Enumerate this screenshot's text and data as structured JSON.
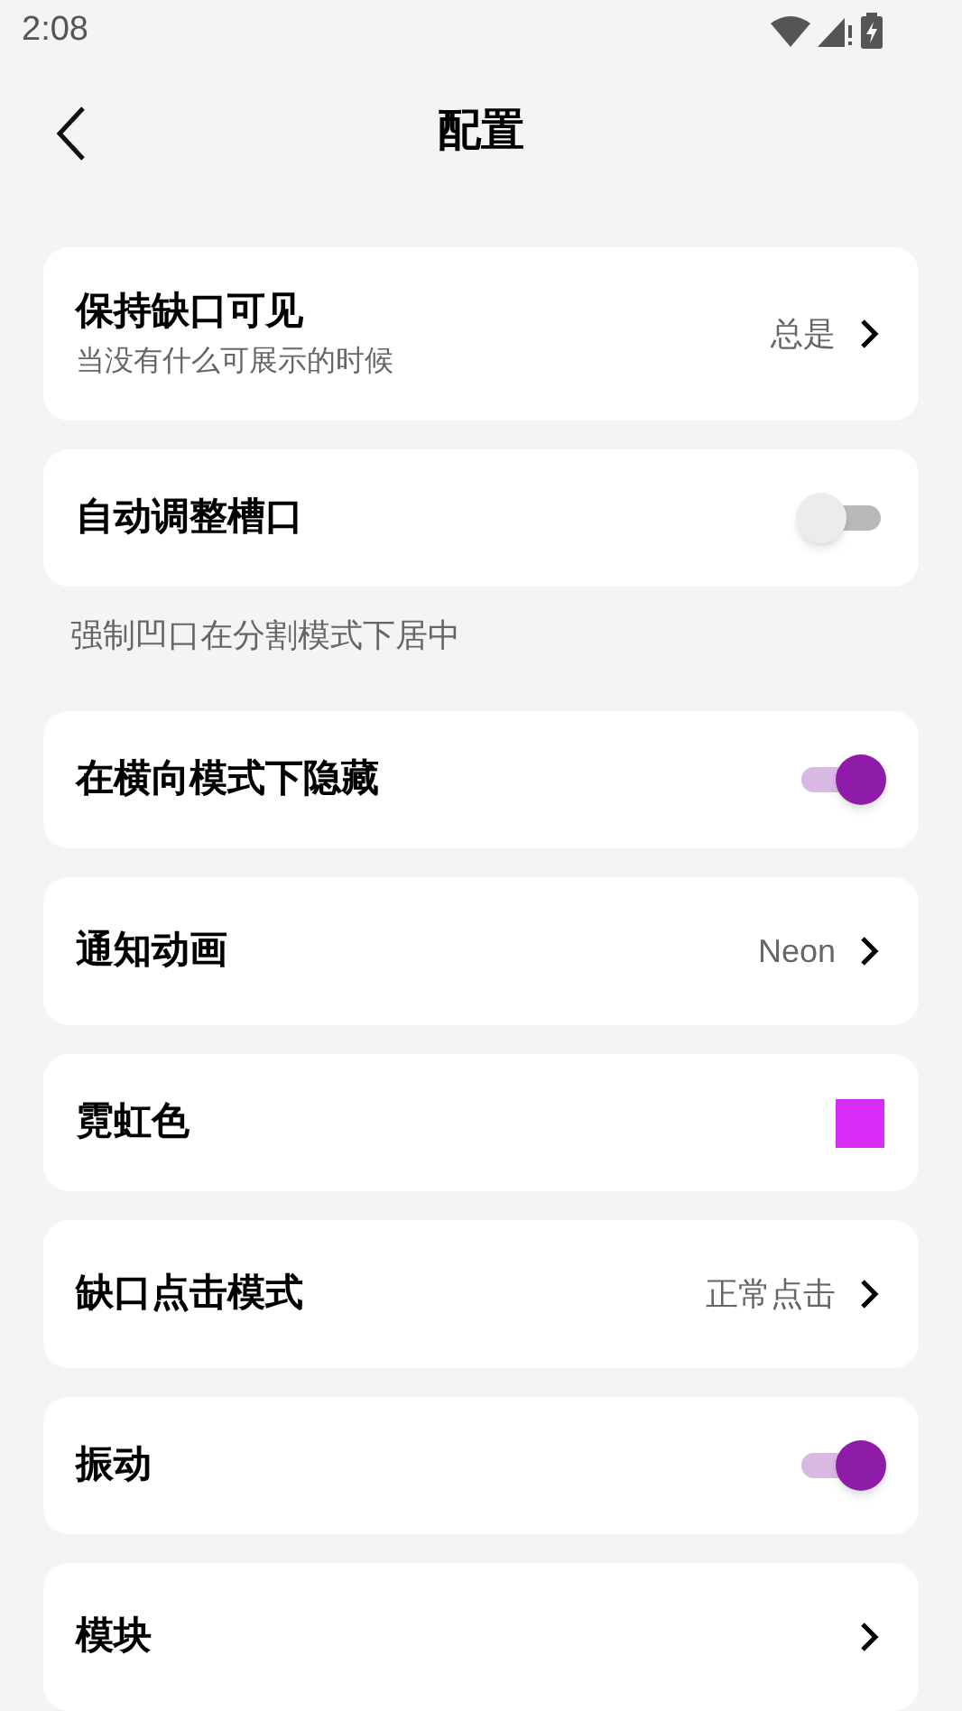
{
  "status_bar": {
    "time": "2:08"
  },
  "header": {
    "title": "配置"
  },
  "items": [
    {
      "kind": "link",
      "title": "保持缺口可见",
      "subtitle": "当没有什么可展示的时候",
      "value": "总是"
    },
    {
      "kind": "toggle",
      "title": "自动调整槽口",
      "on": false
    },
    {
      "kind": "note",
      "text": "强制凹口在分割模式下居中"
    },
    {
      "kind": "toggle",
      "title": "在横向模式下隐藏",
      "on": true
    },
    {
      "kind": "link",
      "title": "通知动画",
      "value": "Neon"
    },
    {
      "kind": "color",
      "title": "霓虹色",
      "color": "#d62cf5"
    },
    {
      "kind": "link",
      "title": "缺口点击模式",
      "value": "正常点击"
    },
    {
      "kind": "toggle",
      "title": "振动",
      "on": true
    },
    {
      "kind": "link",
      "title": "模块"
    }
  ]
}
